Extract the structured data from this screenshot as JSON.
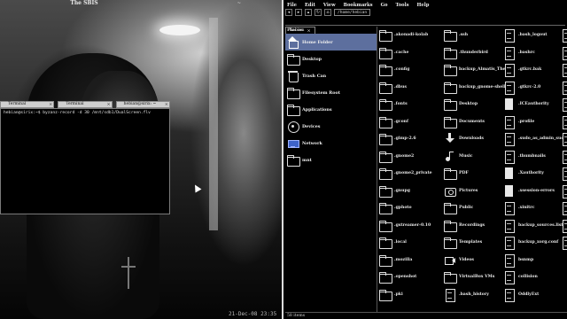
{
  "desktop": {
    "top_title": "The SBIS",
    "top_title_right": "~",
    "timestamp": "21-Dec-08 23:35",
    "terminal_tabs": [
      "Terminal",
      "Terminal",
      "hebian@sirix: ~"
    ],
    "terminal_line": "hebian@sirix:~$ byzanz-record -d 30 /mnt/sdb1/DualScreen.flv"
  },
  "file_manager": {
    "menu": [
      "File",
      "Edit",
      "View",
      "Bookmarks",
      "Go",
      "Tools",
      "Help"
    ],
    "location": "/home/hebian",
    "tab_label": "hebian",
    "places_header": "Places",
    "places": [
      {
        "label": "Home Folder",
        "icon": "home-icon",
        "selected": true
      },
      {
        "label": "Desktop",
        "icon": "folder-icon",
        "selected": false
      },
      {
        "label": "Trash Can",
        "icon": "trash-icon",
        "selected": false
      },
      {
        "label": "Filesystem Root",
        "icon": "folder-icon",
        "selected": false
      },
      {
        "label": "Applications",
        "icon": "folder-icon",
        "selected": false
      },
      {
        "label": "Devices",
        "icon": "disk-icon",
        "selected": false
      },
      {
        "label": "Network",
        "icon": "network-icon",
        "selected": false
      },
      {
        "label": "mnt",
        "icon": "folder-icon",
        "selected": false
      }
    ],
    "columns": [
      [
        {
          "name": ".akonadi-kolab",
          "icon": "folder-icon"
        },
        {
          "name": ".cache",
          "icon": "folder-icon"
        },
        {
          "name": ".config",
          "icon": "folder-icon"
        },
        {
          "name": ".dbus",
          "icon": "folder-icon"
        },
        {
          "name": ".fonts",
          "icon": "folder-icon"
        },
        {
          "name": ".gconf",
          "icon": "folder-icon"
        },
        {
          "name": ".gimp-2.6",
          "icon": "folder-icon"
        },
        {
          "name": ".gnome2",
          "icon": "folder-icon"
        },
        {
          "name": ".gnome2_private",
          "icon": "folder-icon"
        },
        {
          "name": ".gnupg",
          "icon": "folder-icon"
        },
        {
          "name": ".gphoto",
          "icon": "folder-icon"
        },
        {
          "name": ".gstreamer-0.10",
          "icon": "folder-icon"
        },
        {
          "name": ".local",
          "icon": "folder-icon"
        },
        {
          "name": ".mozilla",
          "icon": "folder-icon"
        },
        {
          "name": ".openshot",
          "icon": "folder-icon"
        },
        {
          "name": ".pki",
          "icon": "folder-icon"
        }
      ],
      [
        {
          "name": ".ssh",
          "icon": "folder-icon"
        },
        {
          "name": ".thunderbird",
          "icon": "folder-icon"
        },
        {
          "name": "backup_Almatis_Theme",
          "icon": "folder-icon"
        },
        {
          "name": "backup_gnome-shell",
          "icon": "folder-icon"
        },
        {
          "name": "Desktop",
          "icon": "folder-icon"
        },
        {
          "name": "Documents",
          "icon": "folder-icon"
        },
        {
          "name": "Downloads",
          "icon": "download-icon"
        },
        {
          "name": "Music",
          "icon": "music-icon"
        },
        {
          "name": "PDF",
          "icon": "folder-icon"
        },
        {
          "name": "Pictures",
          "icon": "camera-icon"
        },
        {
          "name": "Public",
          "icon": "folder-icon"
        },
        {
          "name": "Recordings",
          "icon": "folder-icon"
        },
        {
          "name": "Templates",
          "icon": "folder-icon"
        },
        {
          "name": "Videos",
          "icon": "video-icon"
        },
        {
          "name": "VirtualBox VMs",
          "icon": "folder-icon"
        },
        {
          "name": ".bash_history",
          "icon": "file-icon"
        }
      ],
      [
        {
          "name": ".bash_logout",
          "icon": "file-icon"
        },
        {
          "name": ".bashrc",
          "icon": "file-icon"
        },
        {
          "name": ".gtkrc.bak",
          "icon": "file-icon"
        },
        {
          "name": ".gtkrc-2.0",
          "icon": "file-icon"
        },
        {
          "name": ".ICEauthority",
          "icon": "filled-file-icon"
        },
        {
          "name": ".profile",
          "icon": "file-icon"
        },
        {
          "name": ".sudo_as_admin_successful",
          "icon": "file-icon"
        },
        {
          "name": ".thumbnails",
          "icon": "file-icon"
        },
        {
          "name": ".Xauthority",
          "icon": "filled-file-icon"
        },
        {
          "name": ".xsession-errors",
          "icon": "filled-file-icon"
        },
        {
          "name": ".xinitrc",
          "icon": "file-icon"
        },
        {
          "name": "backup_sources.list",
          "icon": "file-icon"
        },
        {
          "name": "backup_xorg.conf",
          "icon": "file-icon"
        },
        {
          "name": "bsnmp",
          "icon": "file-icon"
        },
        {
          "name": "collision",
          "icon": "file-icon"
        },
        {
          "name": "OddlyExt",
          "icon": "file-icon"
        }
      ],
      [
        {
          "name": "",
          "icon": "file-icon"
        },
        {
          "name": "",
          "icon": "file-icon"
        },
        {
          "name": "",
          "icon": "file-icon"
        },
        {
          "name": "",
          "icon": "file-icon"
        },
        {
          "name": "",
          "icon": "file-icon"
        },
        {
          "name": "",
          "icon": "file-icon"
        },
        {
          "name": "",
          "icon": "file-icon"
        },
        {
          "name": "",
          "icon": "file-icon"
        },
        {
          "name": "",
          "icon": "file-icon"
        },
        {
          "name": "",
          "icon": "file-icon"
        },
        {
          "name": "",
          "icon": "file-icon"
        },
        {
          "name": "",
          "icon": "file-icon"
        },
        {
          "name": "",
          "icon": "file-icon"
        }
      ]
    ],
    "status": "58 items"
  }
}
